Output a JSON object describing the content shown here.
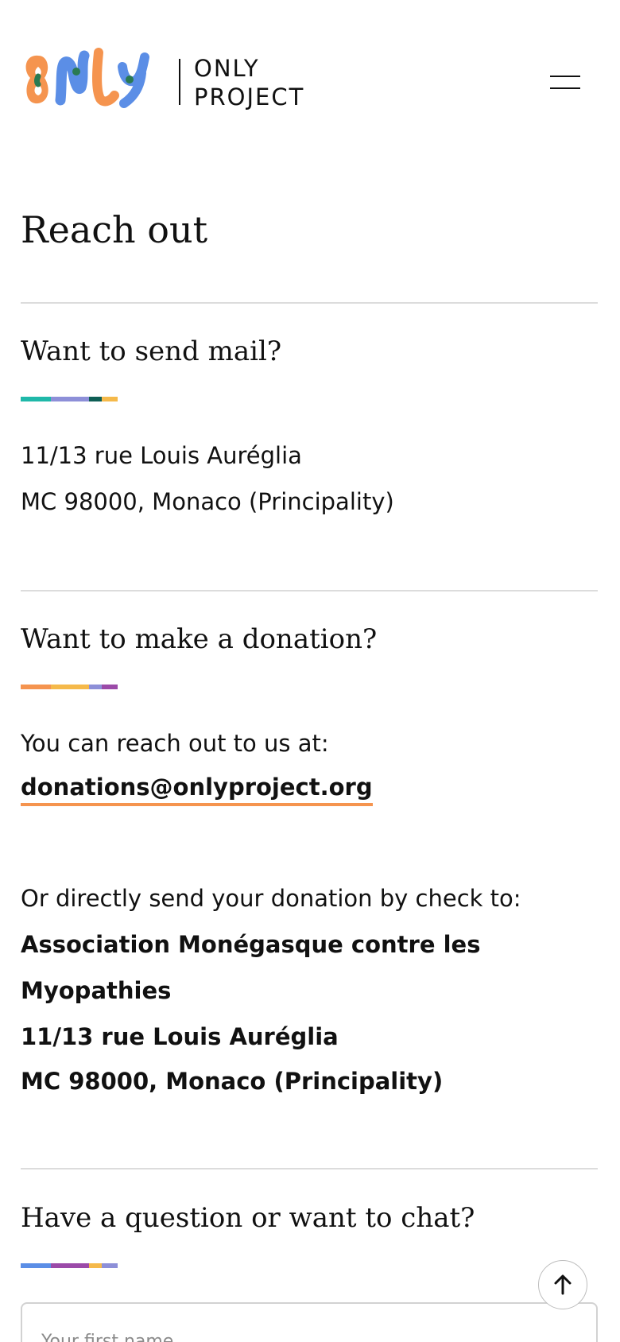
{
  "header": {
    "logo_text_line1": "ONLY",
    "logo_text_line2": "PROJECT",
    "menu_icon": "hamburger-menu-icon",
    "logo_colors": [
      "#f5944f",
      "#5b8ee6",
      "#2a7a52"
    ]
  },
  "page": {
    "title": "Reach out"
  },
  "mail_section": {
    "title": "Want to send mail?",
    "accent_colors": [
      "#1fb8a9",
      "#8d8fd8",
      "#0e5e55",
      "#f5b94a"
    ],
    "address_line1": "11/13 rue Louis Auréglia",
    "address_line2": "MC 98000, Monaco (Principality)"
  },
  "donation_section": {
    "title": "Want to make a donation?",
    "accent_colors": [
      "#f5944f",
      "#f5b94a",
      "#8d8fd8",
      "#9b4aa8"
    ],
    "reach_text": "You can reach out to us at:",
    "email": "donations@onlyproject.org",
    "check_text": "Or directly send your donation by check to:",
    "org_line1": "Association Monégasque contre les",
    "org_line2": "Myopathies",
    "org_address1": "11/13 rue Louis Auréglia",
    "org_address2": "MC 98000, Monaco (Principality)"
  },
  "chat_section": {
    "title": "Have a question or want to chat?",
    "accent_colors": [
      "#5b8ee6",
      "#9b4aa8",
      "#f5b94a",
      "#8d8fd8"
    ],
    "first_name_placeholder": "Your first name"
  },
  "scroll_top": {
    "icon": "arrow-up-icon"
  },
  "colors": {
    "email_underline": "#f5944f",
    "divider": "#dcdcdc"
  }
}
